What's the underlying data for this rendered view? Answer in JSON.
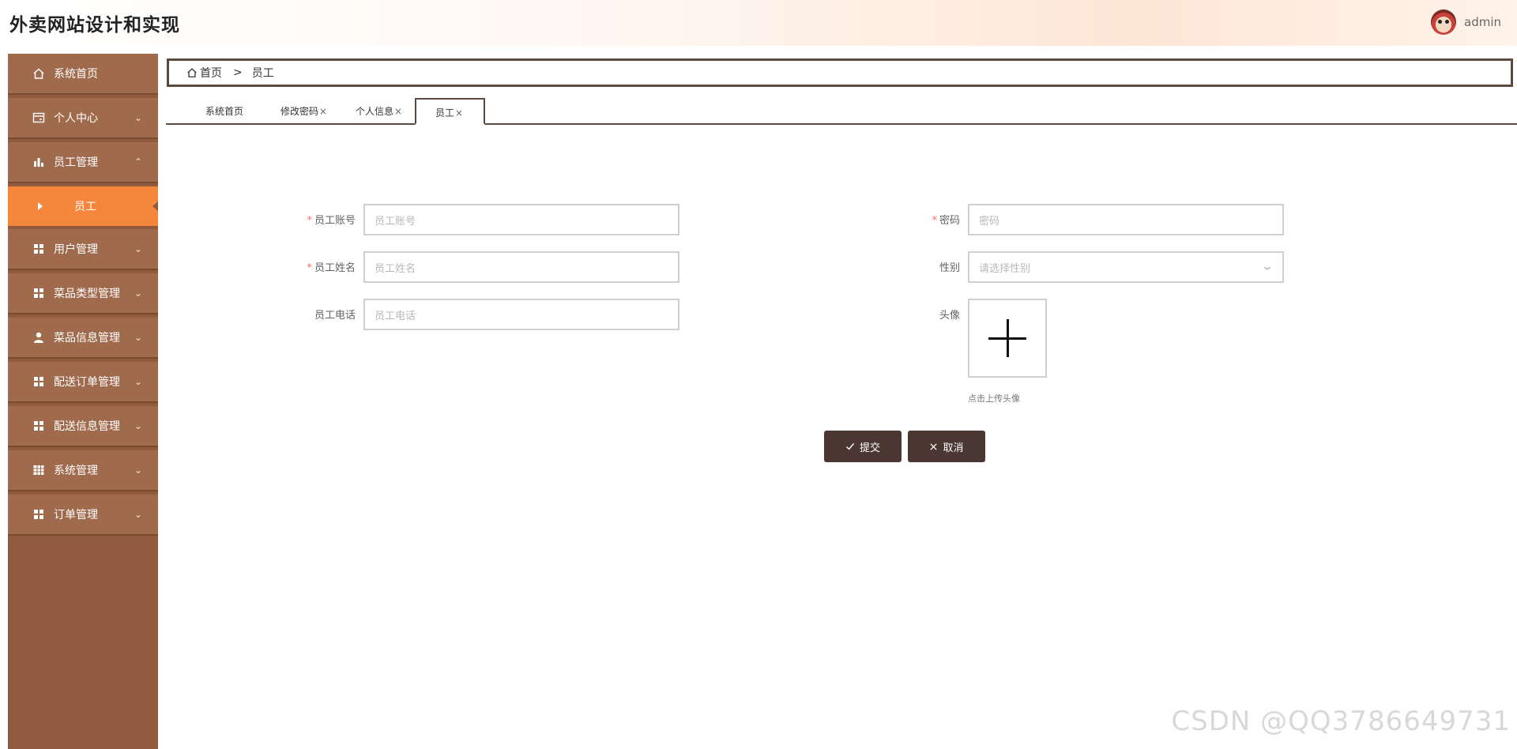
{
  "header": {
    "title": "外卖网站设计和实现",
    "user_name": "admin"
  },
  "sidebar": {
    "items": [
      {
        "label": "系统首页",
        "icon": "home-icon"
      },
      {
        "label": "个人中心",
        "icon": "card-icon"
      },
      {
        "label": "员工管理",
        "icon": "bar-chart-icon"
      },
      {
        "label": "用户管理",
        "icon": "grid-icon"
      },
      {
        "label": "菜品类型管理",
        "icon": "grid-icon"
      },
      {
        "label": "菜品信息管理",
        "icon": "user-icon"
      },
      {
        "label": "配送订单管理",
        "icon": "grid-icon"
      },
      {
        "label": "配送信息管理",
        "icon": "grid-icon"
      },
      {
        "label": "系统管理",
        "icon": "table-icon"
      },
      {
        "label": "订单管理",
        "icon": "grid-icon"
      }
    ],
    "active_sub": "员工"
  },
  "breadcrumb": {
    "home": "首页",
    "separator": ">",
    "current": "员工"
  },
  "tabs": [
    {
      "label": "系统首页",
      "closable": false
    },
    {
      "label": "修改密码",
      "closable": true
    },
    {
      "label": "个人信息",
      "closable": true
    },
    {
      "label": "员工",
      "closable": true,
      "active": true
    }
  ],
  "form": {
    "account": {
      "label": "员工账号",
      "placeholder": "员工账号",
      "required": true
    },
    "password": {
      "label": "密码",
      "placeholder": "密码",
      "required": true
    },
    "name": {
      "label": "员工姓名",
      "placeholder": "员工姓名",
      "required": true
    },
    "gender": {
      "label": "性别",
      "placeholder": "请选择性别"
    },
    "phone": {
      "label": "员工电话",
      "placeholder": "员工电话"
    },
    "avatar": {
      "label": "头像",
      "tip": "点击上传头像"
    },
    "submit": "提交",
    "cancel": "取消"
  },
  "close_glyph": "×",
  "required_mark": "*",
  "watermark": "CSDN @QQ3786649731",
  "colors": {
    "sidebar_bg": "#8f5a3e",
    "menu_item": "#a06a4c",
    "active_sub": "#f5873d",
    "button": "#4a3732",
    "border_dark": "#5b4a40"
  }
}
